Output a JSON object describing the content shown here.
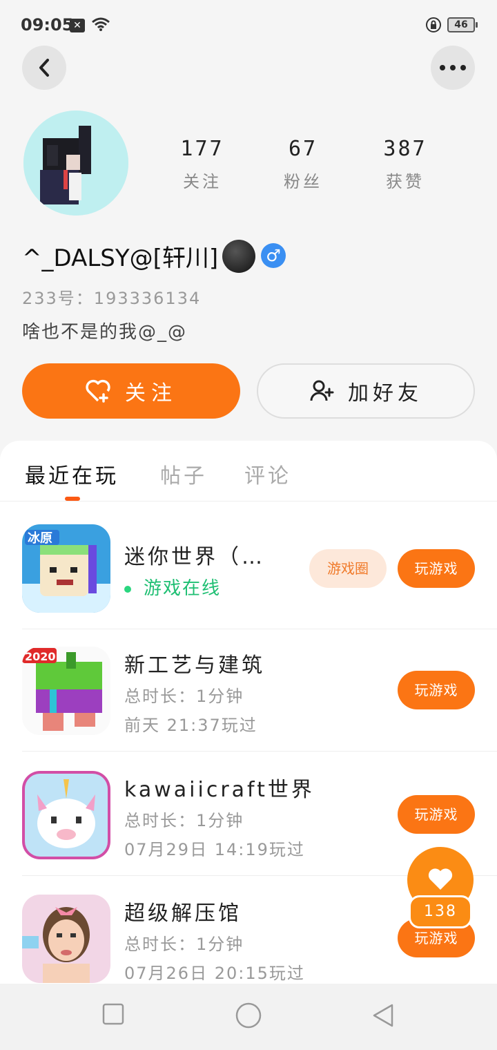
{
  "status_bar": {
    "time": "09:05",
    "battery": "46"
  },
  "profile": {
    "stats": [
      {
        "value": "177",
        "label": "关注"
      },
      {
        "value": "67",
        "label": "粉丝"
      },
      {
        "value": "387",
        "label": "获赞"
      }
    ],
    "nickname": "^_DALSY@[轩川]",
    "gender_symbol": "♂",
    "uid": "233号：193336134",
    "bio": "啥也不是的我@_@"
  },
  "actions": {
    "follow_label": "关注",
    "add_friend_label": "加好友"
  },
  "tabs": [
    {
      "label": "最近在玩",
      "active": true
    },
    {
      "label": "帖子",
      "active": false
    },
    {
      "label": "评论",
      "active": false
    }
  ],
  "games": [
    {
      "title": "迷你世界（…",
      "status": "游戏在线",
      "circle_label": "游戏圈",
      "play_label": "玩游戏",
      "icon_badge": "冰原"
    },
    {
      "title": "新工艺与建筑",
      "duration": "总时长：1分钟",
      "last_played": "前天 21:37玩过",
      "play_label": "玩游戏",
      "icon_badge": "2020"
    },
    {
      "title": "kawaiicraft世界",
      "duration": "总时长：1分钟",
      "last_played": "07月29日 14:19玩过",
      "play_label": "玩游戏"
    },
    {
      "title": "超级解压馆",
      "duration": "总时长：1分钟",
      "last_played": "07月26日 20:15玩过",
      "play_label": "玩游戏"
    }
  ],
  "like_fab": {
    "count": "138"
  },
  "colors": {
    "accent": "#fb7514",
    "online": "#1fbf73",
    "gender_blue": "#3a8ff2"
  }
}
